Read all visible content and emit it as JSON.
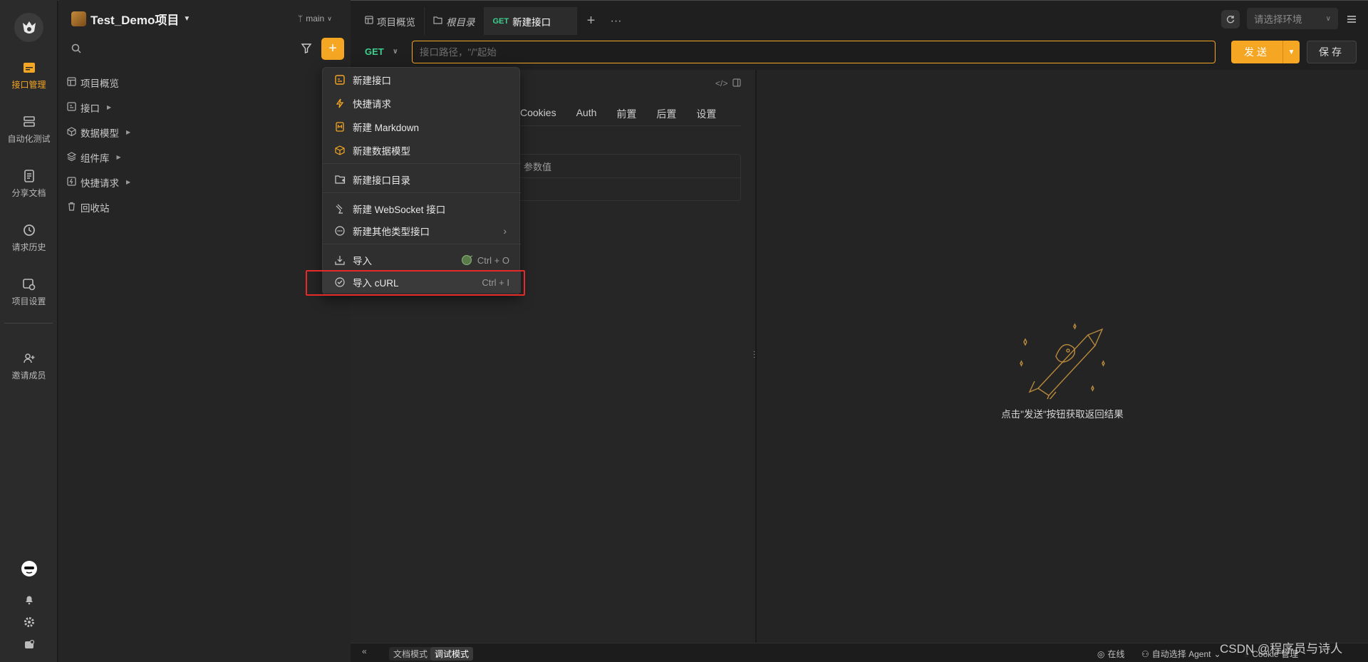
{
  "rail": {
    "items": [
      {
        "label": "接口管理",
        "icon": "api-manage-icon",
        "active": true
      },
      {
        "label": "自动化测试",
        "icon": "automation-icon",
        "active": false
      },
      {
        "label": "分享文档",
        "icon": "share-doc-icon",
        "active": false
      },
      {
        "label": "请求历史",
        "icon": "history-icon",
        "active": false
      },
      {
        "label": "项目设置",
        "icon": "project-settings-icon",
        "active": false
      },
      {
        "label": "邀请成员",
        "icon": "invite-member-icon",
        "active": false
      }
    ]
  },
  "sidebar": {
    "project_name": "Test_Demo项目",
    "tree": [
      {
        "label": "项目概览",
        "icon": "overview-icon",
        "has_caret": false
      },
      {
        "label": "接口",
        "icon": "api-icon",
        "has_caret": true
      },
      {
        "label": "数据模型",
        "icon": "cube-icon",
        "has_caret": true
      },
      {
        "label": "组件库",
        "icon": "layers-icon",
        "has_caret": true
      },
      {
        "label": "快捷请求",
        "icon": "quick-request-icon",
        "has_caret": true
      },
      {
        "label": "回收站",
        "icon": "trash-icon",
        "has_caret": false
      }
    ]
  },
  "topbar": {
    "branch": "main",
    "tabs": [
      {
        "label": "项目概览",
        "icon": "overview-icon",
        "method": "",
        "italic": false,
        "active": false
      },
      {
        "label": "根目录",
        "icon": "folder-icon",
        "method": "",
        "italic": true,
        "active": false
      },
      {
        "label": "新建接口",
        "icon": "",
        "method": "GET",
        "italic": false,
        "active": true
      }
    ],
    "env_placeholder": "请选择环境"
  },
  "request": {
    "method": "GET",
    "url_placeholder": "接口路径，\"/\"起始",
    "send_label": "发送",
    "save_label": "保存",
    "param_tabs": [
      "Cookies",
      "Auth",
      "前置",
      "后置",
      "设置"
    ],
    "param_value_header": "参数值"
  },
  "response": {
    "hint": "点击\"发送\"按钮获取返回结果"
  },
  "dropdown": {
    "items": [
      {
        "label": "新建接口",
        "icon": "new-api-icon",
        "shortcut": ""
      },
      {
        "label": "快捷请求",
        "icon": "lightning-icon",
        "shortcut": ""
      },
      {
        "label": "新建 Markdown",
        "icon": "markdown-icon",
        "shortcut": ""
      },
      {
        "label": "新建数据模型",
        "icon": "data-model-icon",
        "shortcut": ""
      },
      {
        "label": "新建接口目录",
        "icon": "folder-plus-icon",
        "shortcut": ""
      },
      {
        "label": "新建 WebSocket 接口",
        "icon": "websocket-icon",
        "shortcut": ""
      },
      {
        "label": "新建其他类型接口",
        "icon": "more-circle-icon",
        "shortcut": ""
      },
      {
        "label": "导入",
        "icon": "import-icon",
        "shortcut": "Ctrl + O"
      },
      {
        "label": "导入 cURL",
        "icon": "curl-icon",
        "shortcut": "Ctrl + I"
      }
    ]
  },
  "bottom": {
    "doc_mode": "文档模式",
    "debug_mode": "调试模式",
    "online": "在线",
    "agent": "自动选择 Agent",
    "cookie": "Cookie 管理"
  },
  "watermark": "CSDN @程序员与诗人",
  "colors": {
    "accent": "#f5a623",
    "get_method": "#3ecf8e",
    "highlight_box": "#e52a2a"
  }
}
